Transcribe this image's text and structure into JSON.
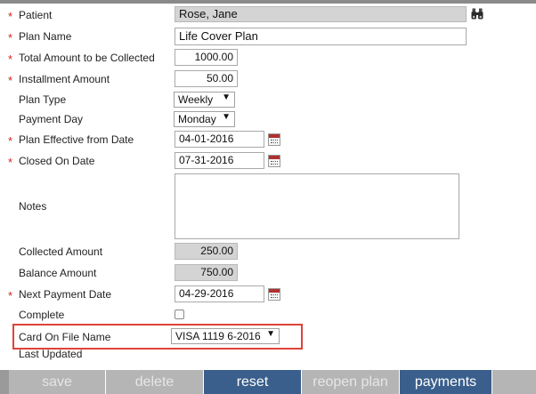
{
  "form": {
    "patient": {
      "label": "Patient",
      "value": "Rose, Jane"
    },
    "plan_name": {
      "label": "Plan Name",
      "value": "Life Cover Plan"
    },
    "total_amount": {
      "label": "Total Amount to be Collected",
      "value": "1000.00"
    },
    "installment_amount": {
      "label": "Installment Amount",
      "value": "50.00"
    },
    "plan_type": {
      "label": "Plan Type",
      "value": "Weekly"
    },
    "payment_day": {
      "label": "Payment Day",
      "value": "Monday"
    },
    "effective_date": {
      "label": "Plan Effective from Date",
      "value": "04-01-2016"
    },
    "closed_date": {
      "label": "Closed On Date",
      "value": "07-31-2016"
    },
    "notes": {
      "label": "Notes",
      "value": ""
    },
    "collected_amount": {
      "label": "Collected Amount",
      "value": "250.00"
    },
    "balance_amount": {
      "label": "Balance Amount",
      "value": "750.00"
    },
    "next_payment_date": {
      "label": "Next Payment Date",
      "value": "04-29-2016"
    },
    "complete": {
      "label": "Complete",
      "checked": false
    },
    "card_on_file": {
      "label": "Card On File Name",
      "value": "VISA 1119 6-2016"
    },
    "last_updated": {
      "label": "Last Updated"
    }
  },
  "required_marker": "*",
  "buttons": {
    "save": "save",
    "delete": "delete",
    "reset": "reset",
    "reopen": "reopen plan",
    "payments": "payments"
  },
  "colors": {
    "required": "#d42020",
    "highlight": "#e0423a",
    "active_button": "#3a5f8c",
    "disabled_button": "#b5b5b5"
  }
}
